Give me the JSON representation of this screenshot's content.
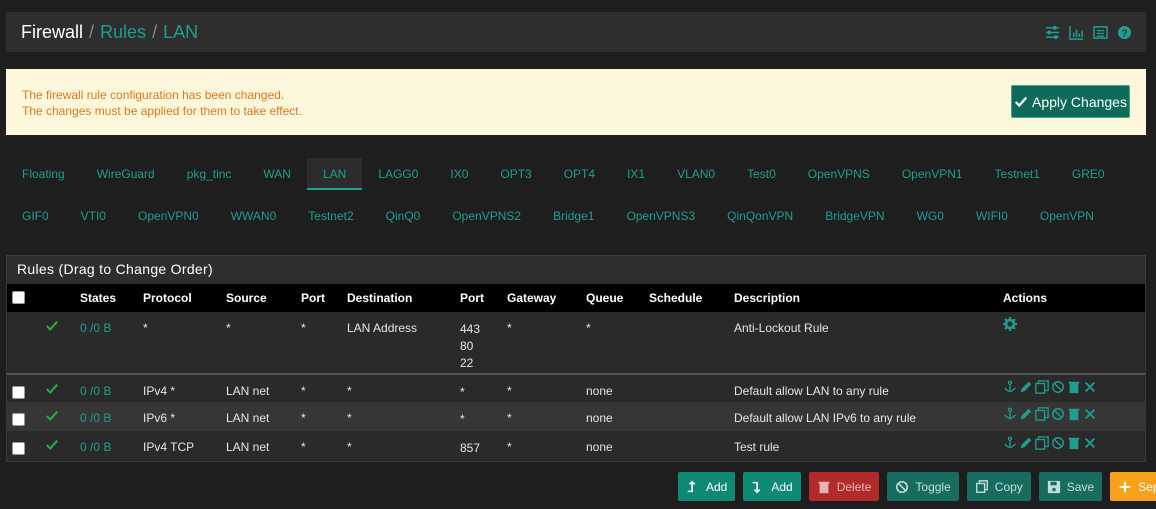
{
  "breadcrumb": {
    "root": "Firewall",
    "sep": "/",
    "rules": "Rules",
    "iface": "LAN"
  },
  "header_icons": [
    "sliders-icon",
    "chart-icon",
    "list-icon",
    "help-icon"
  ],
  "alert": {
    "line1": "The firewall rule configuration has been changed.",
    "line2": "The changes must be applied for them to take effect.",
    "apply_label": "Apply Changes"
  },
  "tabs_row1": [
    "Floating",
    "WireGuard",
    "pkg_tinc",
    "WAN",
    "LAN",
    "LAGG0",
    "IX0",
    "OPT3",
    "OPT4",
    "IX1",
    "VLAN0",
    "Test0",
    "OpenVPNS",
    "OpenVPN1",
    "Testnet1",
    "GRE0"
  ],
  "tabs_row2": [
    "GIF0",
    "VTI0",
    "OpenVPN0",
    "WWAN0",
    "Testnet2",
    "QinQ0",
    "OpenVPNS2",
    "Bridge1",
    "OpenVPNS3",
    "QinQonVPN",
    "BridgeVPN",
    "WG0",
    "WIFI0",
    "OpenVPN"
  ],
  "active_tab": "LAN",
  "panel": {
    "title": "Rules (Drag to Change Order)",
    "columns": [
      "States",
      "Protocol",
      "Source",
      "Port",
      "Destination",
      "Port",
      "Gateway",
      "Queue",
      "Schedule",
      "Description",
      "Actions"
    ]
  },
  "rows": [
    {
      "states": "0 /0 B",
      "protocol": "*",
      "source": "*",
      "sport": "*",
      "destination": "LAN Address",
      "dport": "443\n80\n22",
      "gateway": "*",
      "queue": "*",
      "schedule": "",
      "description": "Anti-Lockout Rule",
      "selectable": false
    },
    {
      "states": "0 /0 B",
      "protocol": "IPv4 *",
      "source": "LAN net",
      "sport": "*",
      "destination": "*",
      "dport": "*",
      "gateway": "*",
      "queue": "none",
      "schedule": "",
      "description": "Default allow LAN to any rule",
      "selectable": true
    },
    {
      "states": "0 /0 B",
      "protocol": "IPv6 *",
      "source": "LAN net",
      "sport": "*",
      "destination": "*",
      "dport": "*",
      "gateway": "*",
      "queue": "none",
      "schedule": "",
      "description": "Default allow LAN IPv6 to any rule",
      "selectable": true
    },
    {
      "states": "0 /0 B",
      "protocol": "IPv4 TCP",
      "source": "LAN net",
      "sport": "*",
      "destination": "*",
      "dport": "857",
      "gateway": "*",
      "queue": "none",
      "schedule": "",
      "description": "Test rule",
      "selectable": true
    }
  ],
  "buttons": {
    "add_top": "Add",
    "add_bottom": "Add",
    "delete": "Delete",
    "toggle": "Toggle",
    "copy": "Copy",
    "save": "Save",
    "separator": "Separator"
  },
  "colors": {
    "accent": "#1e9e8e",
    "alert_text": "#e3761a",
    "alert_bg": "#fdf8dc",
    "danger": "#b22b2b",
    "warning": "#f7a21b"
  }
}
